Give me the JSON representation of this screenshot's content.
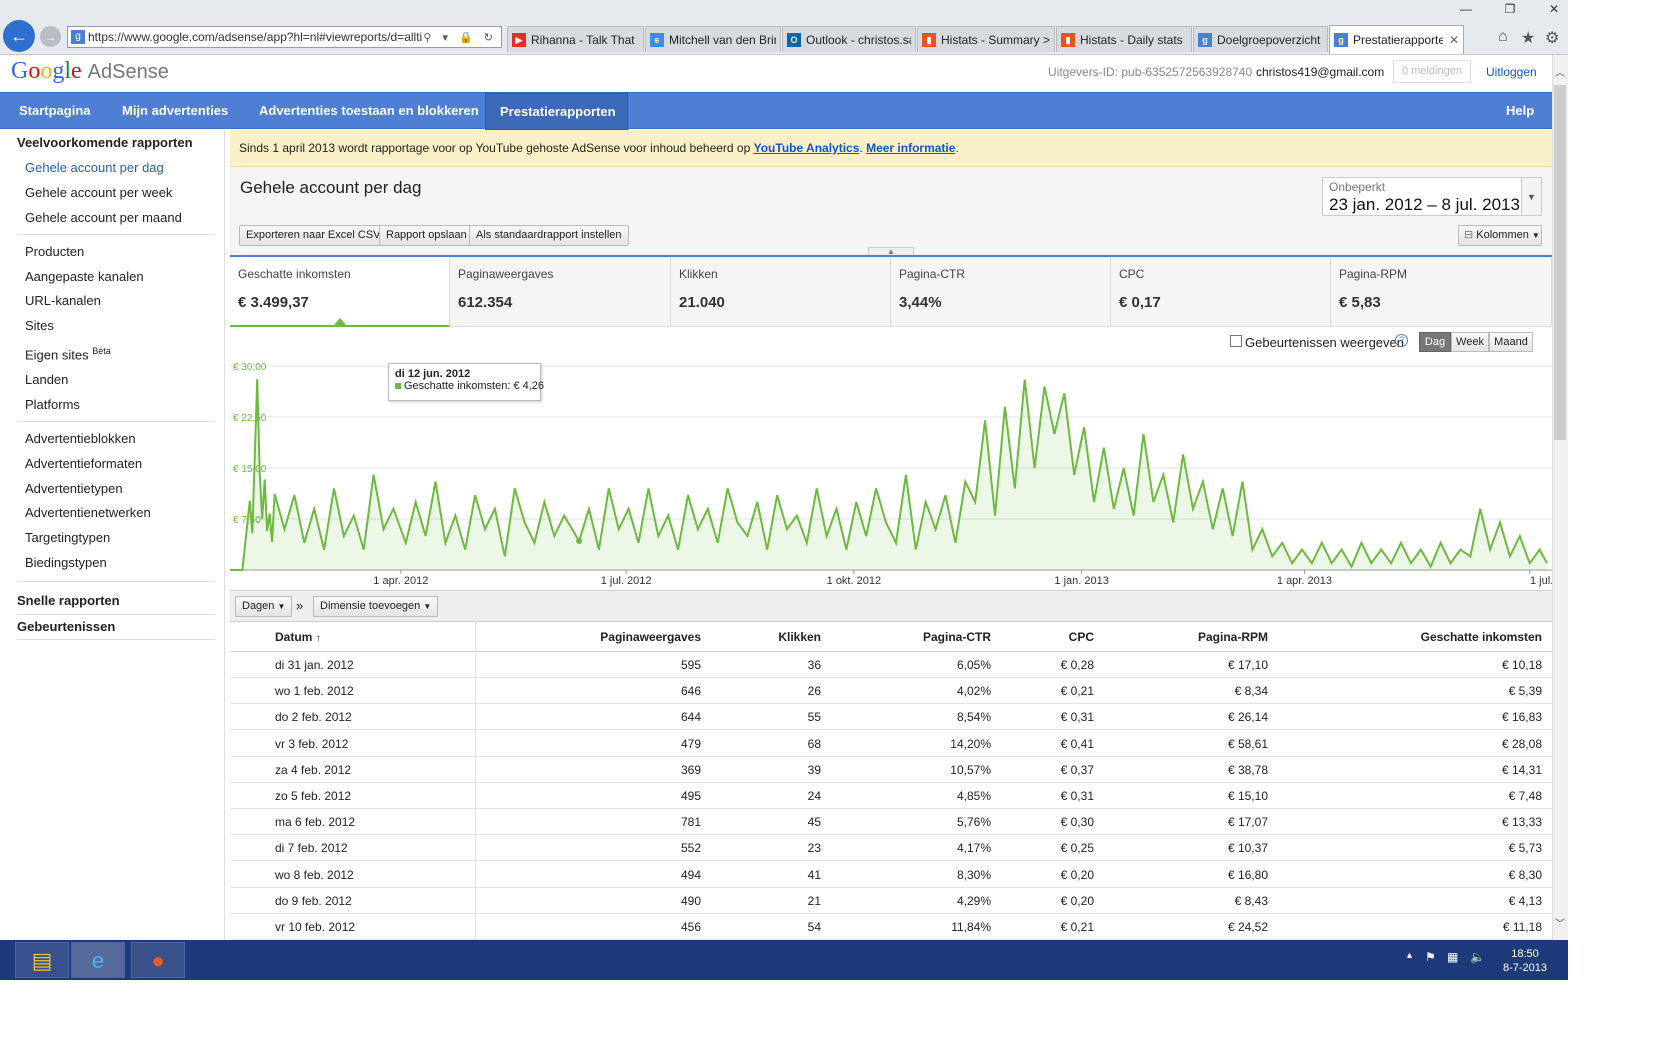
{
  "browser": {
    "url": "https://www.google.com/adsense/app?hl=nl#viewreports/d=alltime8",
    "addr_icons": "⚲ ▾ 🔒 ↻",
    "tabs": [
      {
        "label": "Rihanna - Talk That ...",
        "icon": "youtube-icon"
      },
      {
        "label": "Mitchell van den Brink",
        "icon": "ie-page-icon"
      },
      {
        "label": "Outlook - christos.sa...",
        "icon": "outlook-icon"
      },
      {
        "label": "Histats - Summary > ...",
        "icon": "histats-icon"
      },
      {
        "label": "Histats - Daily stats ...",
        "icon": "histats-icon"
      },
      {
        "label": "Doelgroepoverzicht ...",
        "icon": "google-icon"
      },
      {
        "label": "Prestatierapporte...",
        "icon": "google-icon",
        "active": true
      }
    ],
    "colors": {
      "accent": "#4a7ed8",
      "back_button": "#2f6fd0"
    }
  },
  "header": {
    "logo_google": "Google",
    "logo_product": "AdSense",
    "publisher_id": "Uitgevers-ID: pub-6352572563928740",
    "email": "christos419@gmail.com",
    "notifications": "0 meldingen",
    "logout": "Uitloggen"
  },
  "nav": {
    "items": [
      "Startpagina",
      "Mijn advertenties",
      "Advertenties toestaan en blokkeren",
      "Prestatierapporten"
    ],
    "active": "Prestatierapporten",
    "help": "Help",
    "color": "#4f7fd4"
  },
  "sidebar": {
    "common_reports_title": "Veelvoorkomende rapporten",
    "group1": [
      "Gehele account per dag",
      "Gehele account per week",
      "Gehele account per maand"
    ],
    "group2": [
      "Producten",
      "Aangepaste kanalen",
      "URL-kanalen",
      "Sites",
      "Eigen sites",
      "Landen",
      "Platforms"
    ],
    "beta": "Bèta",
    "group3": [
      "Advertentieblokken",
      "Advertentieformaten",
      "Advertentietypen",
      "Advertentienetwerken",
      "Targetingtypen",
      "Biedingstypen"
    ],
    "quick_reports": "Snelle rapporten",
    "events": "Gebeurtenissen"
  },
  "banner": {
    "text": "Sinds 1 april 2013 wordt rapportage voor op YouTube gehoste AdSense voor inhoud beheerd op ",
    "link1": "YouTube Analytics",
    "sep": ". ",
    "link2": "Meer informatie",
    "end": "."
  },
  "report": {
    "title": "Gehele account per dag",
    "buttons": [
      "Exporteren naar Excel CSV",
      "Rapport opslaan",
      "Als standaardrapport instellen"
    ],
    "columns_button": "Kolommen",
    "range_label": "Onbeperkt",
    "range_value": "23 jan. 2012 – 8 jul. 2013"
  },
  "metrics": [
    {
      "label": "Geschatte inkomsten",
      "value": "€ 3.499,37"
    },
    {
      "label": "Paginaweergaves",
      "value": "612.354"
    },
    {
      "label": "Klikken",
      "value": "21.040"
    },
    {
      "label": "Pagina-CTR",
      "value": "3,44%"
    },
    {
      "label": "CPC",
      "value": "€ 0,17"
    },
    {
      "label": "Pagina-RPM",
      "value": "€ 5,83"
    }
  ],
  "chart_controls": {
    "events_label": "Gebeurtenissen weergeven",
    "periods": [
      "Dag",
      "Week",
      "Maand"
    ],
    "active_period": "Dag"
  },
  "tooltip": {
    "date": "di 12 jun. 2012",
    "line": "Geschatte inkomsten: € 4,26"
  },
  "chart_data": {
    "type": "area",
    "series": [
      {
        "name": "Geschatte inkomsten"
      }
    ],
    "color": "#6cba3e",
    "ylim": [
      0,
      30
    ],
    "yticks": [
      "€ 30,00",
      "€ 22,50",
      "€ 15,00",
      "€ 7,50"
    ],
    "xticks": [
      "1 apr. 2012",
      "1 jul. 2012",
      "1 okt. 2012",
      "1 jan. 2013",
      "1 apr. 2013",
      "1 jul. ..."
    ],
    "grid": true,
    "points": [
      [
        "2012-01-23",
        0
      ],
      [
        "2012-01-28",
        0
      ],
      [
        "2012-01-31",
        10.18
      ],
      [
        "2012-02-01",
        5.39
      ],
      [
        "2012-02-02",
        16.83
      ],
      [
        "2012-02-03",
        28.08
      ],
      [
        "2012-02-04",
        14.31
      ],
      [
        "2012-02-05",
        7.48
      ],
      [
        "2012-02-06",
        13.33
      ],
      [
        "2012-02-07",
        5.73
      ],
      [
        "2012-02-08",
        8.3
      ],
      [
        "2012-02-09",
        4.13
      ],
      [
        "2012-02-10",
        11.18
      ],
      [
        "2012-02-14",
        6
      ],
      [
        "2012-02-18",
        11
      ],
      [
        "2012-02-22",
        4
      ],
      [
        "2012-02-26",
        9
      ],
      [
        "2012-03-01",
        3
      ],
      [
        "2012-03-05",
        12
      ],
      [
        "2012-03-09",
        5
      ],
      [
        "2012-03-13",
        8
      ],
      [
        "2012-03-17",
        3
      ],
      [
        "2012-03-21",
        14
      ],
      [
        "2012-03-25",
        6
      ],
      [
        "2012-03-29",
        9
      ],
      [
        "2012-04-03",
        4
      ],
      [
        "2012-04-07",
        10
      ],
      [
        "2012-04-11",
        5
      ],
      [
        "2012-04-15",
        13
      ],
      [
        "2012-04-19",
        4
      ],
      [
        "2012-04-23",
        8
      ],
      [
        "2012-04-27",
        3
      ],
      [
        "2012-05-01",
        11
      ],
      [
        "2012-05-05",
        6
      ],
      [
        "2012-05-09",
        9
      ],
      [
        "2012-05-13",
        2
      ],
      [
        "2012-05-17",
        12
      ],
      [
        "2012-05-21",
        7
      ],
      [
        "2012-05-25",
        4
      ],
      [
        "2012-05-29",
        10
      ],
      [
        "2012-06-02",
        5
      ],
      [
        "2012-06-06",
        8
      ],
      [
        "2012-06-12",
        4.26
      ],
      [
        "2012-06-16",
        9
      ],
      [
        "2012-06-20",
        3
      ],
      [
        "2012-06-24",
        12
      ],
      [
        "2012-06-28",
        6
      ],
      [
        "2012-07-02",
        9
      ],
      [
        "2012-07-06",
        4
      ],
      [
        "2012-07-10",
        12
      ],
      [
        "2012-07-14",
        5
      ],
      [
        "2012-07-18",
        8
      ],
      [
        "2012-07-22",
        3
      ],
      [
        "2012-07-26",
        11
      ],
      [
        "2012-07-30",
        6
      ],
      [
        "2012-08-03",
        9
      ],
      [
        "2012-08-07",
        4
      ],
      [
        "2012-08-11",
        12
      ],
      [
        "2012-08-15",
        7
      ],
      [
        "2012-08-19",
        5
      ],
      [
        "2012-08-23",
        10
      ],
      [
        "2012-08-27",
        3
      ],
      [
        "2012-08-31",
        11
      ],
      [
        "2012-09-04",
        6
      ],
      [
        "2012-09-08",
        8
      ],
      [
        "2012-09-12",
        4
      ],
      [
        "2012-09-16",
        12
      ],
      [
        "2012-09-20",
        5
      ],
      [
        "2012-09-24",
        9
      ],
      [
        "2012-09-28",
        3
      ],
      [
        "2012-10-02",
        10
      ],
      [
        "2012-10-06",
        5
      ],
      [
        "2012-10-10",
        12
      ],
      [
        "2012-10-14",
        7
      ],
      [
        "2012-10-18",
        4
      ],
      [
        "2012-10-22",
        14
      ],
      [
        "2012-10-26",
        3
      ],
      [
        "2012-10-30",
        10
      ],
      [
        "2012-11-03",
        6
      ],
      [
        "2012-11-07",
        11
      ],
      [
        "2012-11-11",
        4
      ],
      [
        "2012-11-15",
        13
      ],
      [
        "2012-11-19",
        10
      ],
      [
        "2012-11-23",
        22
      ],
      [
        "2012-11-27",
        8
      ],
      [
        "2012-12-01",
        24
      ],
      [
        "2012-12-05",
        12
      ],
      [
        "2012-12-09",
        28
      ],
      [
        "2012-12-13",
        15
      ],
      [
        "2012-12-17",
        27
      ],
      [
        "2012-12-21",
        20
      ],
      [
        "2012-12-25",
        26
      ],
      [
        "2012-12-29",
        14
      ],
      [
        "2013-01-02",
        21
      ],
      [
        "2013-01-06",
        10
      ],
      [
        "2013-01-10",
        18
      ],
      [
        "2013-01-14",
        9
      ],
      [
        "2013-01-18",
        15
      ],
      [
        "2013-01-22",
        8
      ],
      [
        "2013-01-26",
        20
      ],
      [
        "2013-01-30",
        10
      ],
      [
        "2013-02-03",
        14
      ],
      [
        "2013-02-07",
        7
      ],
      [
        "2013-02-11",
        17
      ],
      [
        "2013-02-15",
        9
      ],
      [
        "2013-02-19",
        13
      ],
      [
        "2013-02-23",
        6
      ],
      [
        "2013-02-27",
        12
      ],
      [
        "2013-03-03",
        5
      ],
      [
        "2013-03-07",
        13
      ],
      [
        "2013-03-11",
        3
      ],
      [
        "2013-03-15",
        6
      ],
      [
        "2013-03-19",
        2
      ],
      [
        "2013-03-23",
        4
      ],
      [
        "2013-03-27",
        1
      ],
      [
        "2013-03-31",
        3
      ],
      [
        "2013-04-04",
        1
      ],
      [
        "2013-04-08",
        4
      ],
      [
        "2013-04-12",
        1
      ],
      [
        "2013-04-16",
        3
      ],
      [
        "2013-04-20",
        0.5
      ],
      [
        "2013-04-24",
        4
      ],
      [
        "2013-04-28",
        1
      ],
      [
        "2013-05-02",
        3
      ],
      [
        "2013-05-06",
        1
      ],
      [
        "2013-05-10",
        4
      ],
      [
        "2013-05-14",
        1
      ],
      [
        "2013-05-18",
        3
      ],
      [
        "2013-05-22",
        0.5
      ],
      [
        "2013-05-26",
        4
      ],
      [
        "2013-05-30",
        1
      ],
      [
        "2013-06-03",
        3
      ],
      [
        "2013-06-07",
        2
      ],
      [
        "2013-06-11",
        9
      ],
      [
        "2013-06-15",
        3
      ],
      [
        "2013-06-19",
        7
      ],
      [
        "2013-06-23",
        2
      ],
      [
        "2013-06-27",
        5
      ],
      [
        "2013-07-01",
        1
      ],
      [
        "2013-07-05",
        3
      ],
      [
        "2013-07-08",
        1
      ]
    ]
  },
  "dimension_bar": {
    "dim_label": "Dagen",
    "separator": "»",
    "add_dim": "Dimensie toevoegen"
  },
  "table": {
    "headers": [
      "Datum",
      "Paginaweergaves",
      "Klikken",
      "Pagina-CTR",
      "CPC",
      "Pagina-RPM",
      "Geschatte inkomsten"
    ],
    "sort_arrow": "↑",
    "rows": [
      [
        "di 31 jan. 2012",
        "595",
        "36",
        "6,05%",
        "€ 0,28",
        "€ 17,10",
        "€ 10,18"
      ],
      [
        "wo 1 feb. 2012",
        "646",
        "26",
        "4,02%",
        "€ 0,21",
        "€ 8,34",
        "€ 5,39"
      ],
      [
        "do 2 feb. 2012",
        "644",
        "55",
        "8,54%",
        "€ 0,31",
        "€ 26,14",
        "€ 16,83"
      ],
      [
        "vr 3 feb. 2012",
        "479",
        "68",
        "14,20%",
        "€ 0,41",
        "€ 58,61",
        "€ 28,08"
      ],
      [
        "za 4 feb. 2012",
        "369",
        "39",
        "10,57%",
        "€ 0,37",
        "€ 38,78",
        "€ 14,31"
      ],
      [
        "zo 5 feb. 2012",
        "495",
        "24",
        "4,85%",
        "€ 0,31",
        "€ 15,10",
        "€ 7,48"
      ],
      [
        "ma 6 feb. 2012",
        "781",
        "45",
        "5,76%",
        "€ 0,30",
        "€ 17,07",
        "€ 13,33"
      ],
      [
        "di 7 feb. 2012",
        "552",
        "23",
        "4,17%",
        "€ 0,25",
        "€ 10,37",
        "€ 5,73"
      ],
      [
        "wo 8 feb. 2012",
        "494",
        "41",
        "8,30%",
        "€ 0,20",
        "€ 16,80",
        "€ 8,30"
      ],
      [
        "do 9 feb. 2012",
        "490",
        "21",
        "4,29%",
        "€ 0,20",
        "€ 8,43",
        "€ 4,13"
      ],
      [
        "vr 10 feb. 2012",
        "456",
        "54",
        "11,84%",
        "€ 0,21",
        "€ 24,52",
        "€ 11,18"
      ]
    ]
  },
  "taskbar": {
    "apps": [
      "file-explorer-icon",
      "internet-explorer-icon",
      "media-player-icon"
    ],
    "time": "18:50",
    "date": "8-7-2013"
  }
}
